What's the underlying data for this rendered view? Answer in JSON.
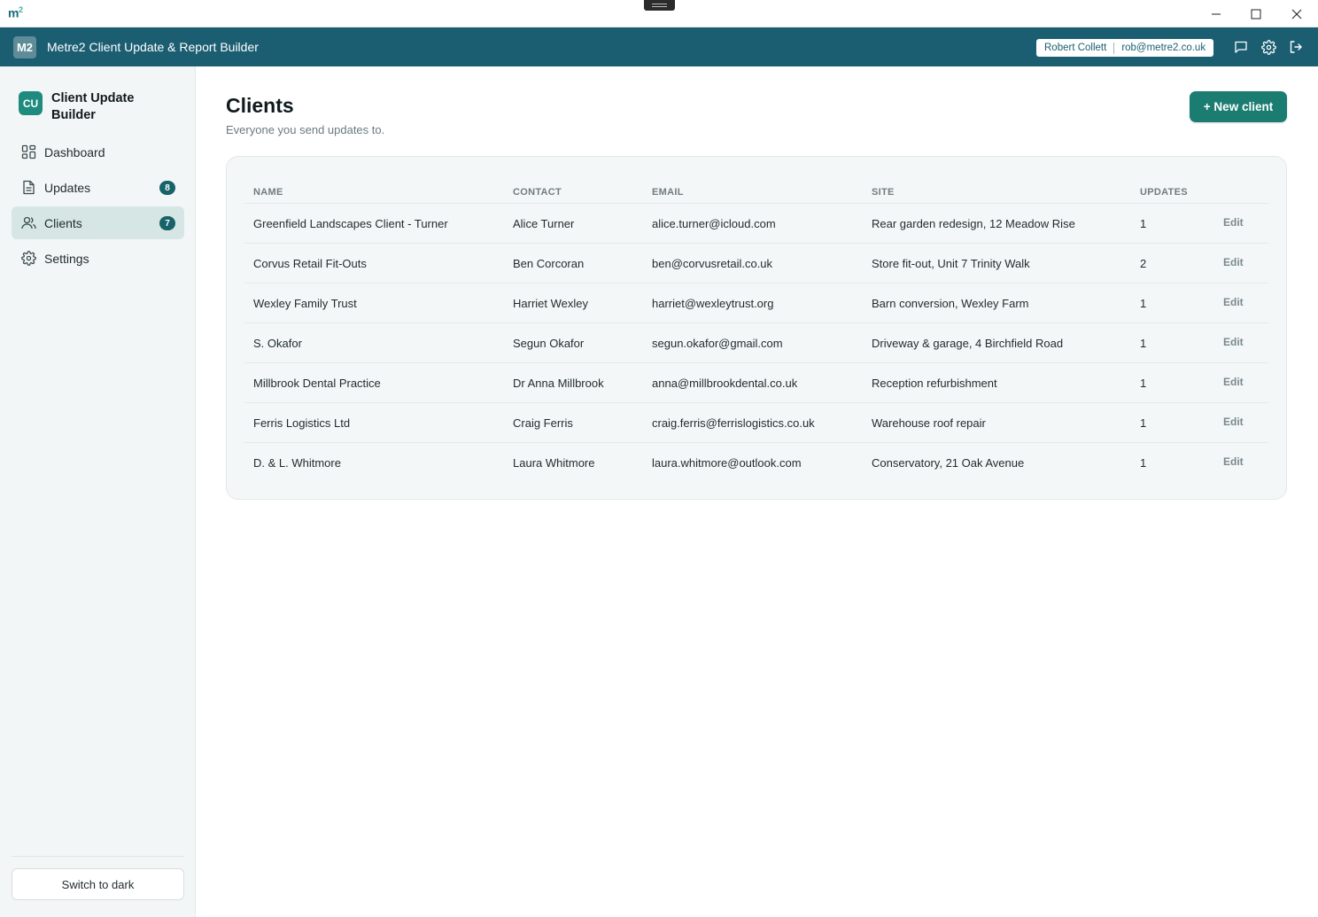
{
  "os": {
    "logo": "m",
    "logo_sup": "2"
  },
  "header": {
    "badge": "M2",
    "title": "Metre2 Client Update & Report Builder",
    "user_name": "Robert Collett",
    "user_email": "rob@metre2.co.uk"
  },
  "sidebar": {
    "brand_badge": "CU",
    "brand_name": "Client Update Builder",
    "items": [
      {
        "label": "Dashboard",
        "icon": "dashboard-icon",
        "badge": ""
      },
      {
        "label": "Updates",
        "icon": "document-icon",
        "badge": "8"
      },
      {
        "label": "Clients",
        "icon": "users-icon",
        "badge": "7",
        "active": true
      },
      {
        "label": "Settings",
        "icon": "gear-icon",
        "badge": ""
      }
    ],
    "theme_toggle": "Switch to dark"
  },
  "main": {
    "title": "Clients",
    "subtitle": "Everyone you send updates to.",
    "new_button": "+ New client",
    "table": {
      "headers": {
        "name": "NAME",
        "contact": "CONTACT",
        "email": "EMAIL",
        "site": "SITE",
        "updates": "UPDATES"
      },
      "edit_label": "Edit",
      "rows": [
        {
          "name": "Greenfield Landscapes Client - Turner",
          "contact": "Alice Turner",
          "email": "alice.turner@icloud.com",
          "site": "Rear garden redesign, 12 Meadow Rise",
          "updates": "1"
        },
        {
          "name": "Corvus Retail Fit-Outs",
          "contact": "Ben Corcoran",
          "email": "ben@corvusretail.co.uk",
          "site": "Store fit-out, Unit 7 Trinity Walk",
          "updates": "2"
        },
        {
          "name": "Wexley Family Trust",
          "contact": "Harriet Wexley",
          "email": "harriet@wexleytrust.org",
          "site": "Barn conversion, Wexley Farm",
          "updates": "1"
        },
        {
          "name": "S. Okafor",
          "contact": "Segun Okafor",
          "email": "segun.okafor@gmail.com",
          "site": "Driveway & garage, 4 Birchfield Road",
          "updates": "1"
        },
        {
          "name": "Millbrook Dental Practice",
          "contact": "Dr Anna Millbrook",
          "email": "anna@millbrookdental.co.uk",
          "site": "Reception refurbishment",
          "updates": "1"
        },
        {
          "name": "Ferris Logistics Ltd",
          "contact": "Craig Ferris",
          "email": "craig.ferris@ferrislogistics.co.uk",
          "site": "Warehouse roof repair",
          "updates": "1"
        },
        {
          "name": "D. & L. Whitmore",
          "contact": "Laura Whitmore",
          "email": "laura.whitmore@outlook.com",
          "site": "Conservatory, 21 Oak Avenue",
          "updates": "1"
        }
      ]
    }
  },
  "colors": {
    "header_bg": "#1b5e72",
    "accent": "#1b7c72",
    "badge_bg": "#17636a",
    "active_nav": "#d6e6e5"
  }
}
